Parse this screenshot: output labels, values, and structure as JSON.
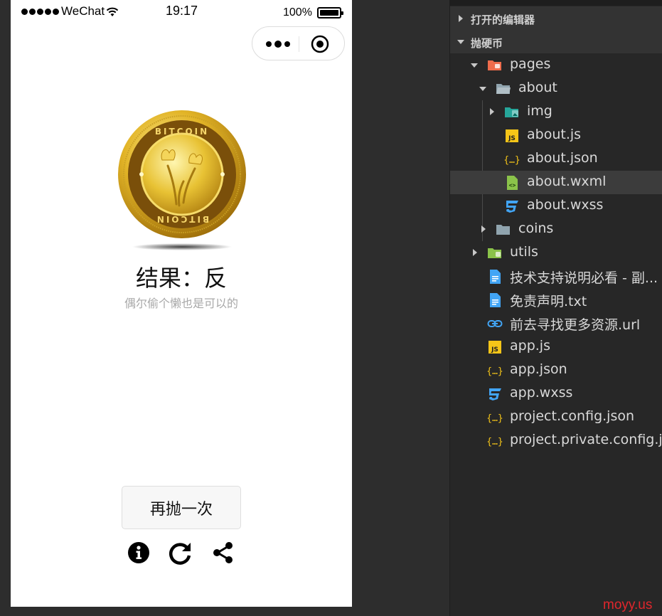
{
  "status_bar": {
    "carrier": "WeChat",
    "time": "19:17",
    "battery": "100%"
  },
  "capsule": {
    "more_icon": "more-dots-icon",
    "close_icon": "target-circle-icon"
  },
  "main": {
    "coin_lettering": "BITCOIN",
    "result_title": "结果：反",
    "result_subtitle": "偶尔偷个懒也是可以的",
    "again_button": "再抛一次",
    "toolbar_icons": [
      "info-icon",
      "redo-icon",
      "share-icon"
    ]
  },
  "explorer": {
    "sections": {
      "open_editors": "打开的编辑器",
      "project": "抛硬币"
    },
    "tree": [
      {
        "label": "pages",
        "icon": "folder-open-icon",
        "expanded": true
      },
      {
        "label": "about",
        "icon": "folder-open-icon",
        "expanded": true
      },
      {
        "label": "img",
        "icon": "folder-image-icon",
        "expanded": false
      },
      {
        "label": "about.js",
        "icon": "js-file-icon"
      },
      {
        "label": "about.json",
        "icon": "json-file-icon"
      },
      {
        "label": "about.wxml",
        "icon": "wxml-file-icon",
        "selected": true
      },
      {
        "label": "about.wxss",
        "icon": "css-file-icon"
      },
      {
        "label": "coins",
        "icon": "folder-icon",
        "expanded": false
      },
      {
        "label": "utils",
        "icon": "folder-utils-icon",
        "expanded": false
      },
      {
        "label": "技术支持说明必看 - 副...",
        "icon": "document-icon"
      },
      {
        "label": "免责声明.txt",
        "icon": "document-icon"
      },
      {
        "label": "前去寻找更多资源.url",
        "icon": "link-icon"
      },
      {
        "label": "app.js",
        "icon": "js-file-icon"
      },
      {
        "label": "app.json",
        "icon": "json-file-icon"
      },
      {
        "label": "app.wxss",
        "icon": "css-file-icon"
      },
      {
        "label": "project.config.json",
        "icon": "json-file-icon"
      },
      {
        "label": "project.private.config.js...",
        "icon": "json-file-icon"
      }
    ]
  },
  "watermark": "moyy.us",
  "colors": {
    "accent_js": "#f5c518",
    "accent_css": "#42a5f5",
    "accent_wxml": "#8bc34a",
    "folder_pages": "#ef6c4c",
    "folder_grey": "#90a4ae",
    "watermark": "#e1262c"
  }
}
